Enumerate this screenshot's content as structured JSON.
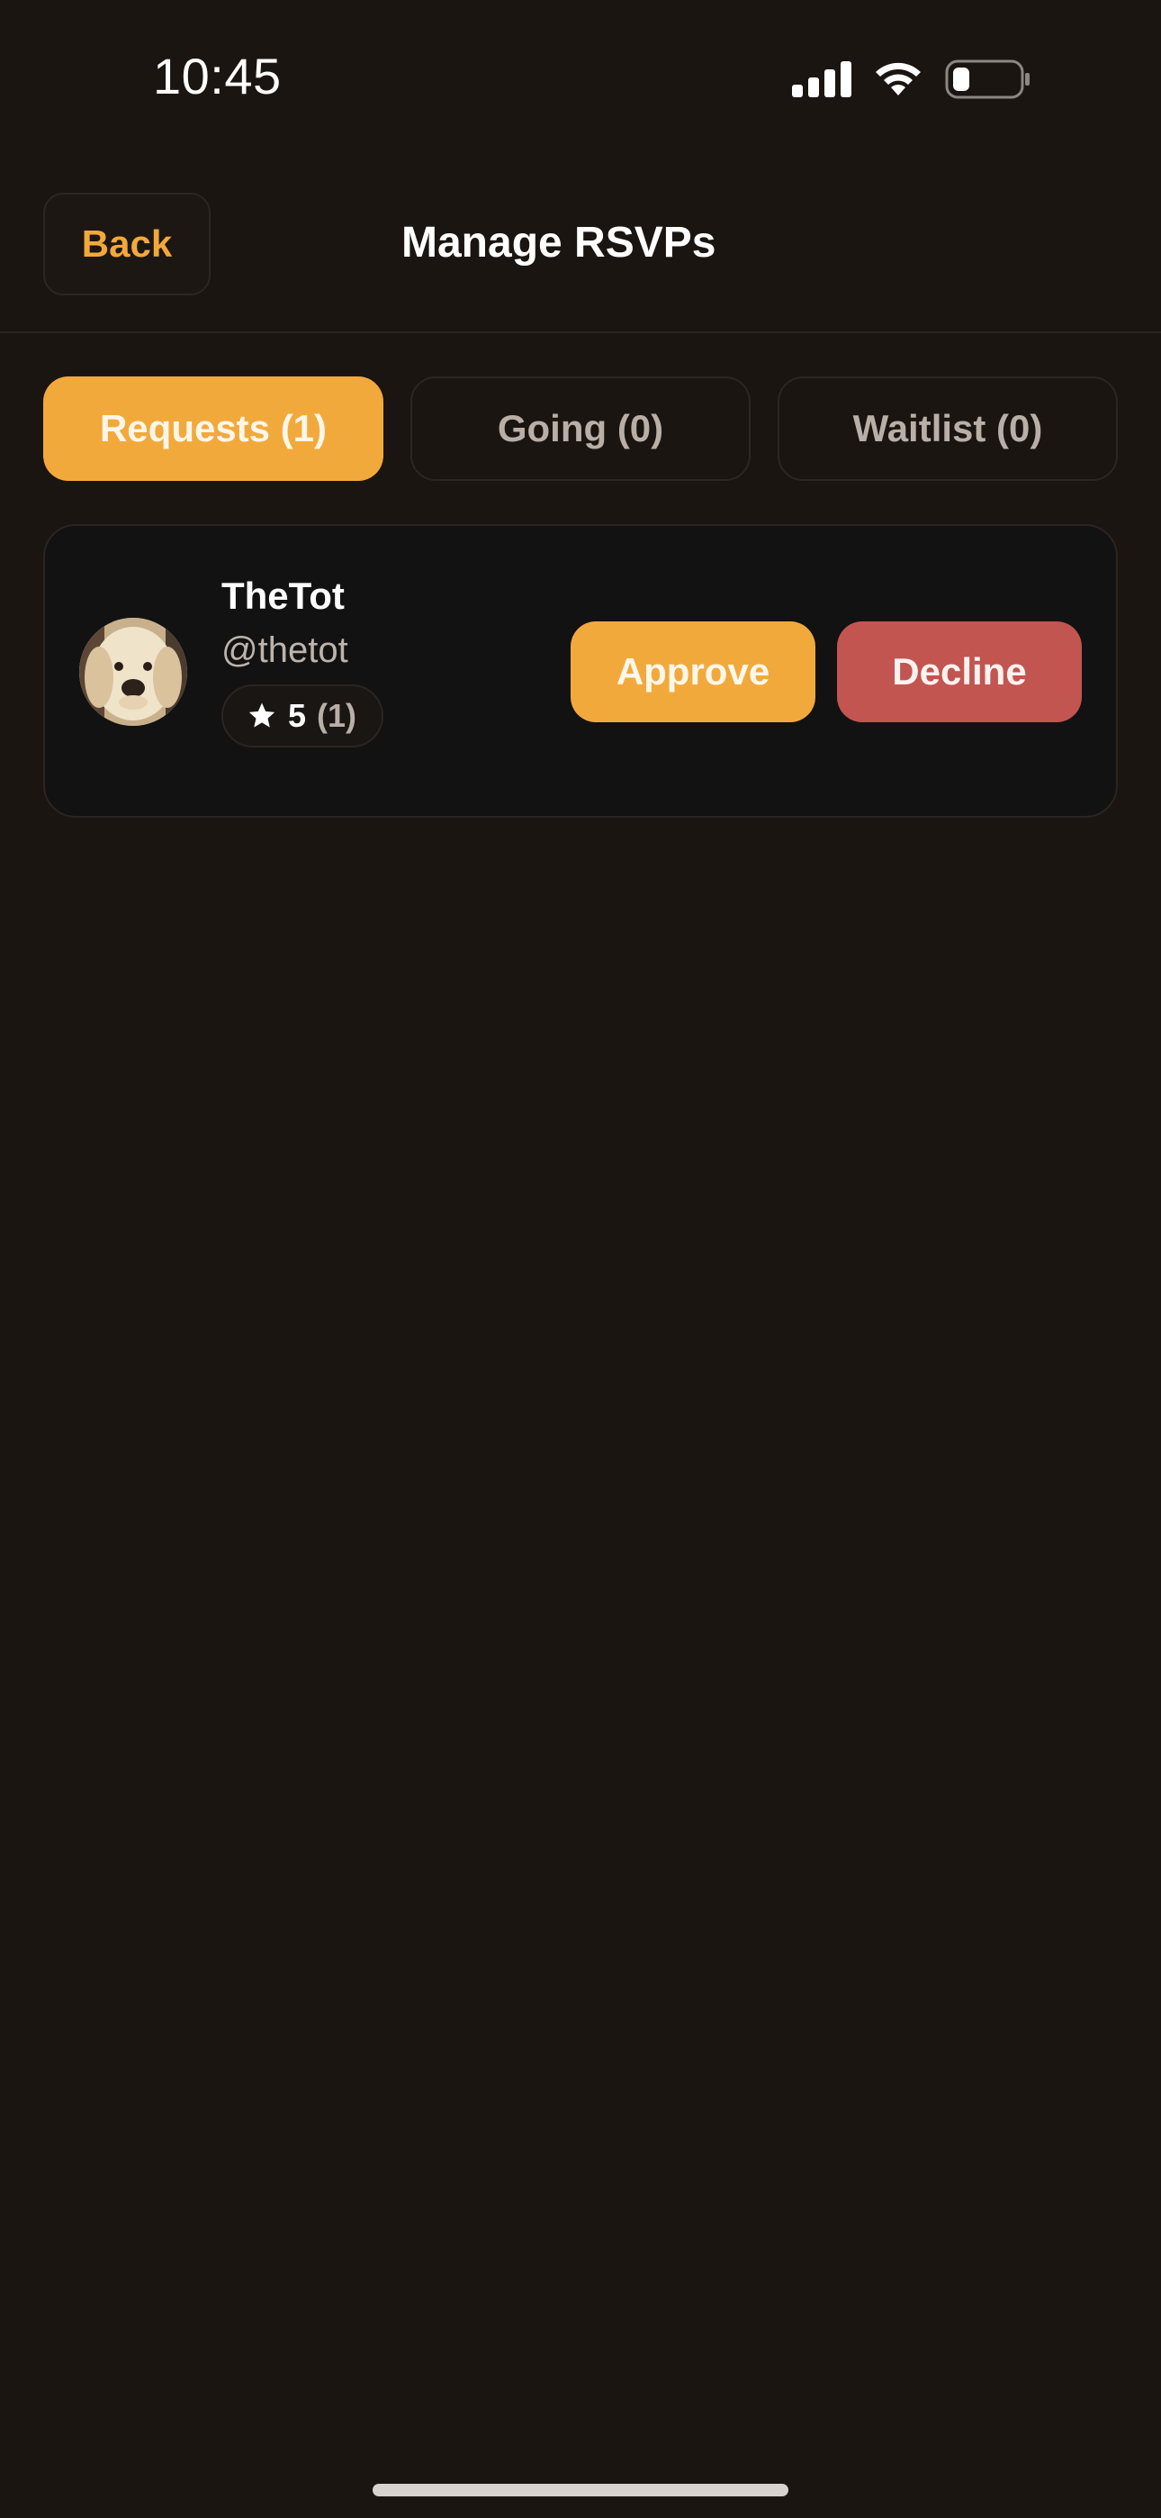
{
  "status_bar": {
    "time": "10:45",
    "icons": [
      "signal-icon",
      "wifi-icon",
      "battery-icon"
    ]
  },
  "header": {
    "back_label": "Back",
    "title": "Manage RSVPs"
  },
  "tabs": [
    {
      "label": "Requests (1)",
      "active": true
    },
    {
      "label": "Going (0)",
      "active": false
    },
    {
      "label": "Waitlist (0)",
      "active": false
    }
  ],
  "requests": [
    {
      "name": "TheTot",
      "handle": "@thetot",
      "rating": "5",
      "rating_count": "(1)",
      "approve_label": "Approve",
      "decline_label": "Decline"
    }
  ],
  "colors": {
    "background": "#1b1512",
    "accent": "#f2a93c",
    "decline": "#c25550",
    "card": "#121212"
  }
}
